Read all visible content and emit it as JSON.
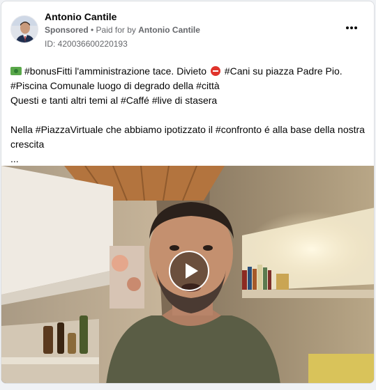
{
  "post": {
    "author": "Antonio Cantile",
    "sponsored_label": "Sponsored",
    "separator": " • ",
    "paid_for_label": "Paid for by ",
    "payer": "Antonio Cantile",
    "ad_id": "ID: 420036600220193",
    "more_icon": "more-horizontal-icon"
  },
  "text": {
    "line1_a": "#bonusFitti l'amministrazione tace. Divieto ",
    "line1_b": " #Cani su piazza Padre Pio.",
    "line2": "#Piscina Comunale luogo di degrado della #città",
    "line3": "Questi e tanti altri temi al #Caffé #live di stasera",
    "line4": "Nella #PiazzaVirtuale che abbiamo ipotizzato il #confronto é alla base della nostra",
    "line5": "crescita",
    "ellipsis": "..."
  },
  "video": {
    "play_icon": "play-icon"
  },
  "colors": {
    "accent_text": "#050505",
    "secondary_text": "#65676b",
    "card_border": "#dadde1"
  }
}
